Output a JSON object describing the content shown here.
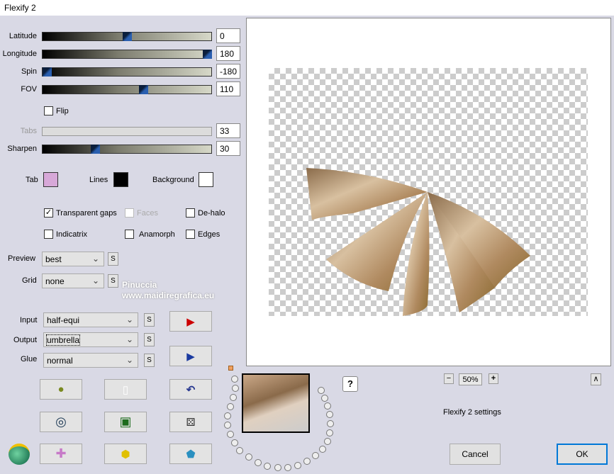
{
  "window": {
    "title": "Flexify 2"
  },
  "sliders": [
    {
      "label": "Latitude",
      "value": "0",
      "fraction": 0.5
    },
    {
      "label": "Longitude",
      "value": "180",
      "fraction": 1.0
    },
    {
      "label": "Spin",
      "value": "-180",
      "fraction": 0.0
    },
    {
      "label": "FOV",
      "value": "110",
      "fraction": 0.6
    },
    {
      "label": "Tabs",
      "value": "33",
      "fraction": 0,
      "disabled": true
    },
    {
      "label": "Sharpen",
      "value": "30",
      "fraction": 0.3
    }
  ],
  "flip": {
    "label": "Flip",
    "checked": false
  },
  "colors": {
    "tab_label": "Tab",
    "tab": "#d7a8d8",
    "lines_label": "Lines",
    "lines": "#000000",
    "background_label": "Background",
    "background": "#ffffff"
  },
  "options": {
    "transparent_gaps": "Transparent gaps",
    "faces": "Faces",
    "de_halo": "De-halo",
    "indicatrix": "Indicatrix",
    "anamorph": "Anamorph",
    "edges": "Edges",
    "check": "✓"
  },
  "selects": {
    "preview_label": "Preview",
    "preview": "best",
    "grid_label": "Grid",
    "grid": "none",
    "input_label": "Input",
    "input": "half-equi",
    "output_label": "Output",
    "output": "umbrella",
    "glue_label": "Glue",
    "glue": "normal",
    "s": "S",
    "chev": "⌄"
  },
  "watermark": {
    "name": "Pinuccia",
    "url": "www.maidiregrafica.eu"
  },
  "zoom": {
    "minus": "−",
    "value": "50%",
    "plus": "+",
    "up": "∧"
  },
  "help": "?",
  "settings_label": "Flexify 2 settings",
  "buttons": {
    "cancel": "Cancel",
    "ok": "OK"
  }
}
